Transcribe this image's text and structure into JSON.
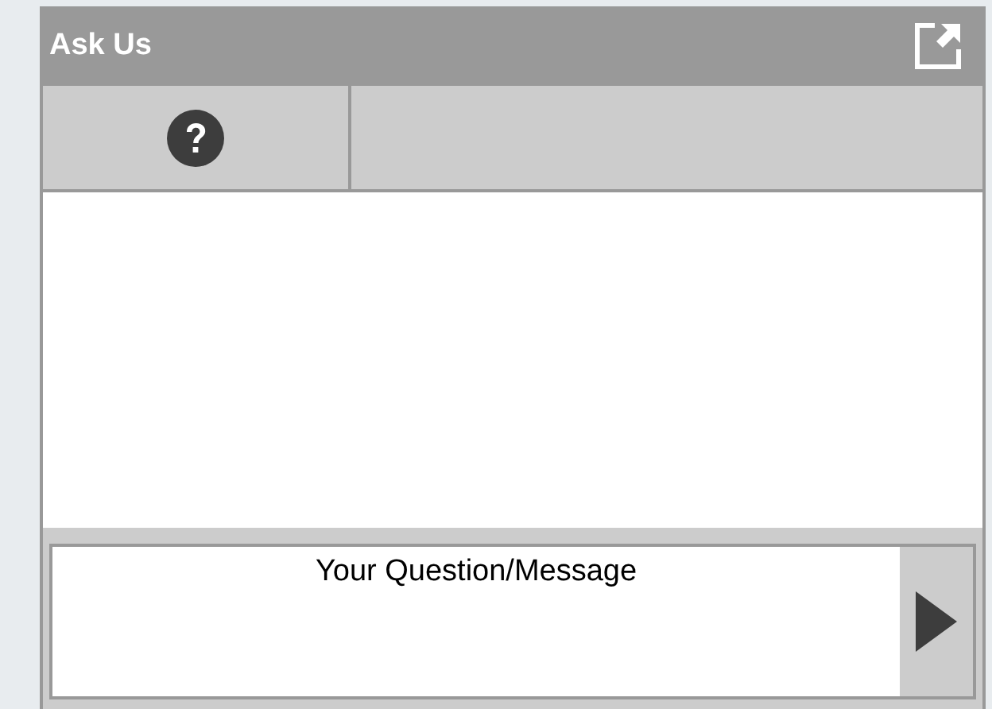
{
  "window": {
    "title": "Ask Us"
  },
  "message": {
    "placeholder": "Your Question/Message"
  }
}
